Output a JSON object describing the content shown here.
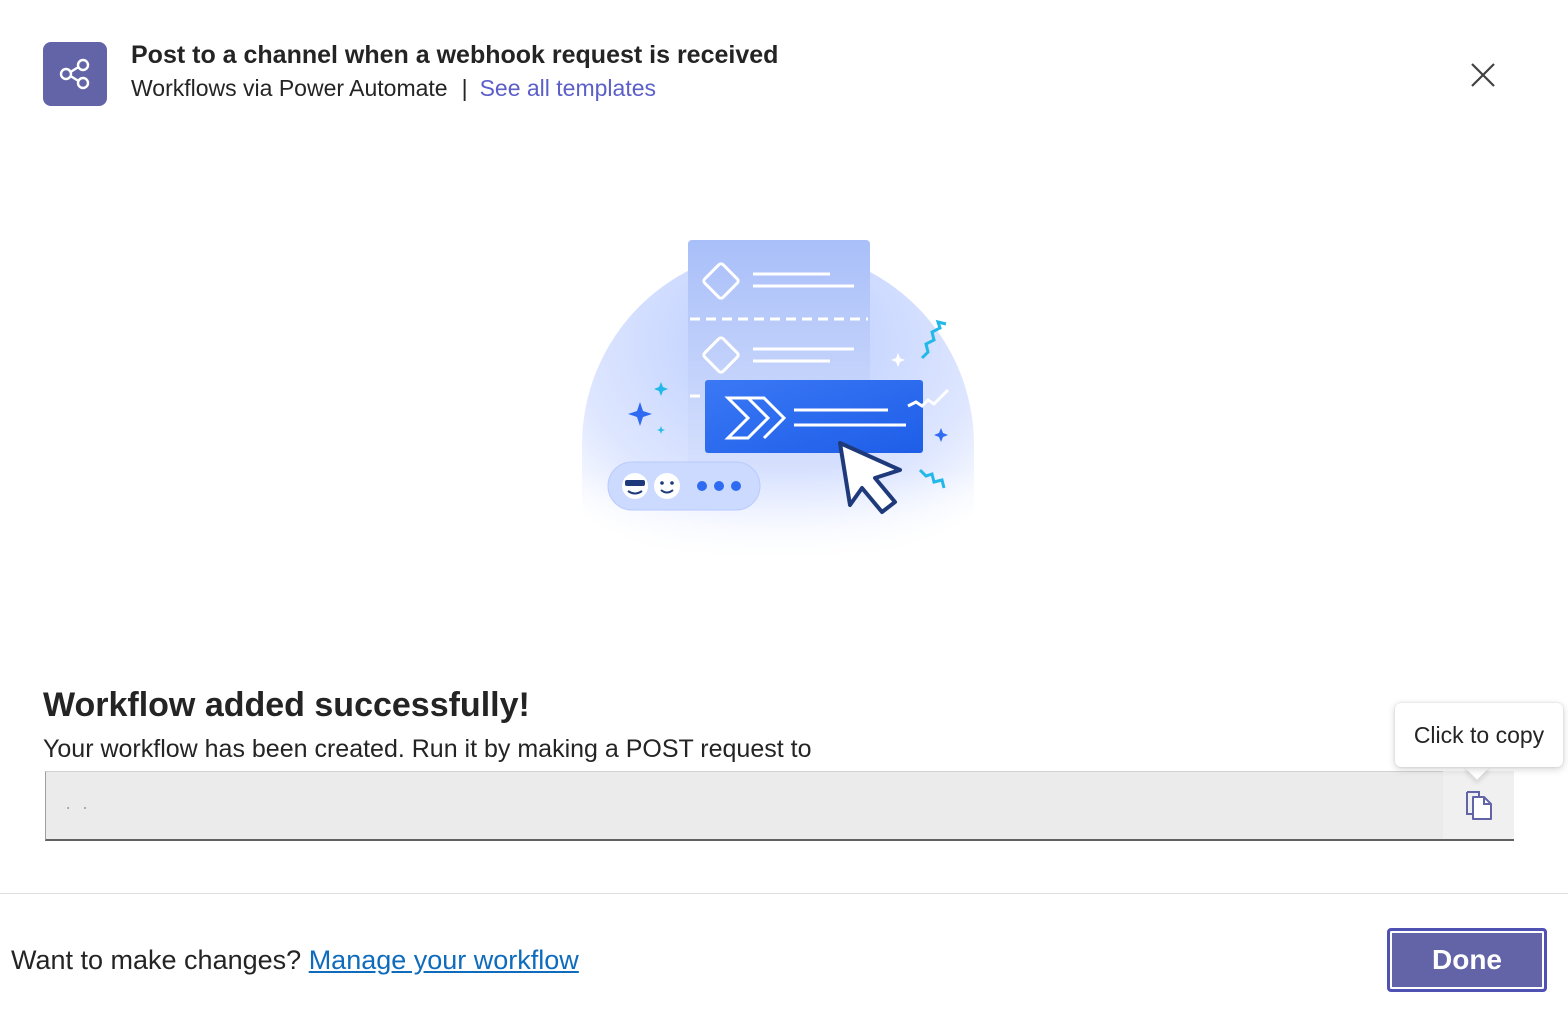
{
  "header": {
    "title": "Post to a channel when a webhook request is received",
    "subtitle": "Workflows via Power Automate",
    "separator": "|",
    "templates_link": "See all templates"
  },
  "success": {
    "title": "Workflow added successfully!",
    "description": "Your workflow has been created. Run it by making a POST request to",
    "url_value": ". ."
  },
  "tooltip": {
    "text": "Click to copy"
  },
  "footer": {
    "prompt": "Want to make changes?",
    "manage_link": "Manage your workflow",
    "done_label": "Done"
  },
  "colors": {
    "brand": "#6264a7",
    "link": "#5b5fc7",
    "footer_link": "#0f6cbd",
    "illustration_primary": "#2f6bf2"
  },
  "icons": {
    "app": "share-nodes-icon",
    "close": "close-icon",
    "copy": "copy-icon"
  }
}
